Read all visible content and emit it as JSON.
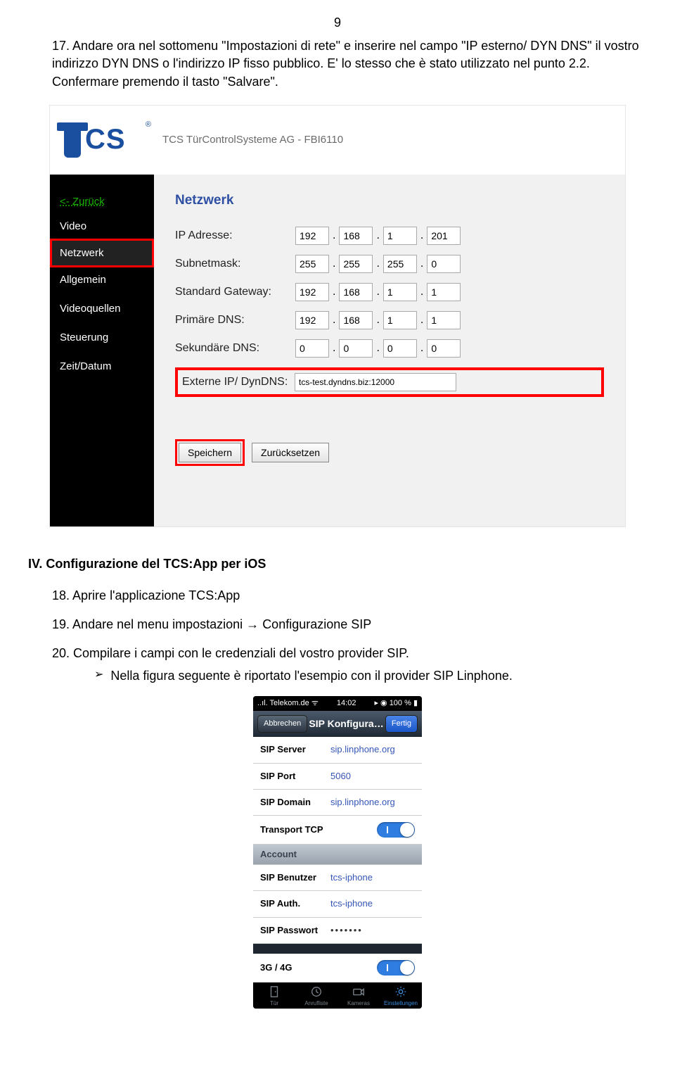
{
  "page_number": "9",
  "step17": {
    "num": "17.",
    "text_a": "Andare ora nel sottomenu \"Impostazioni di rete\" e inserire nel campo \"IP esterno/ DYN DNS\" il vostro indirizzo DYN DNS o l'indirizzo IP fisso pubblico. E' lo stesso che è stato utilizzato nel punto 2.2. Confermare premendo il tasto \"Salvare\"."
  },
  "device_title": "TCS TürControlSysteme AG - FBI6110",
  "sidebar": {
    "back": "<- Zurück",
    "items": [
      "Video",
      "Netzwerk",
      "Allgemein",
      "Videoquellen",
      "Steuerung",
      "Zeit/Datum"
    ]
  },
  "panel": {
    "title": "Netzwerk",
    "fields": {
      "ip_label": "IP Adresse:",
      "ip": [
        "192",
        "168",
        "1",
        "201"
      ],
      "subnet_label": "Subnetmask:",
      "subnet": [
        "255",
        "255",
        "255",
        "0"
      ],
      "gw_label": "Standard Gateway:",
      "gw": [
        "192",
        "168",
        "1",
        "1"
      ],
      "dns1_label": "Primäre DNS:",
      "dns1": [
        "192",
        "168",
        "1",
        "1"
      ],
      "dns2_label": "Sekundäre DNS:",
      "dns2": [
        "0",
        "0",
        "0",
        "0"
      ],
      "ext_label": "Externe IP/ DynDNS:",
      "ext_value": "tcs-test.dyndns.biz:12000"
    },
    "save_btn": "Speichern",
    "reset_btn": "Zurücksetzen"
  },
  "section4": {
    "heading": "IV. Configurazione del TCS:App per iOS",
    "step18": {
      "num": "18.",
      "text": "Aprire l'applicazione TCS:App"
    },
    "step19": {
      "num": "19.",
      "text": "Andare nel menu impostazioni → Configurazione SIP"
    },
    "step20": {
      "num": "20.",
      "text": "Compilare i campi con le credenziali del vostro provider SIP.",
      "bullet": "Nella figura seguente è riportato l'esempio con il provider SIP Linphone."
    }
  },
  "phone": {
    "status_left": "..ıl. Telekom.de",
    "status_wifi": "ᯤ",
    "status_time": "14:02",
    "status_right": "100 %",
    "cancel": "Abbrechen",
    "title": "SIP Konfigura…",
    "done": "Fertig",
    "rows": {
      "server_l": "SIP Server",
      "server_v": "sip.linphone.org",
      "port_l": "SIP Port",
      "port_v": "5060",
      "domain_l": "SIP Domain",
      "domain_v": "sip.linphone.org",
      "tcp_l": "Transport TCP",
      "account_hdr": "Account",
      "user_l": "SIP Benutzer",
      "user_v": "tcs-iphone",
      "auth_l": "SIP Auth.",
      "auth_v": "tcs-iphone",
      "pw_l": "SIP Passwort",
      "pw_v": "•••••••",
      "g_l": "3G / 4G"
    },
    "tabs": [
      "Tür",
      "Anrufliste",
      "Kameras",
      "Einstellungen"
    ]
  }
}
